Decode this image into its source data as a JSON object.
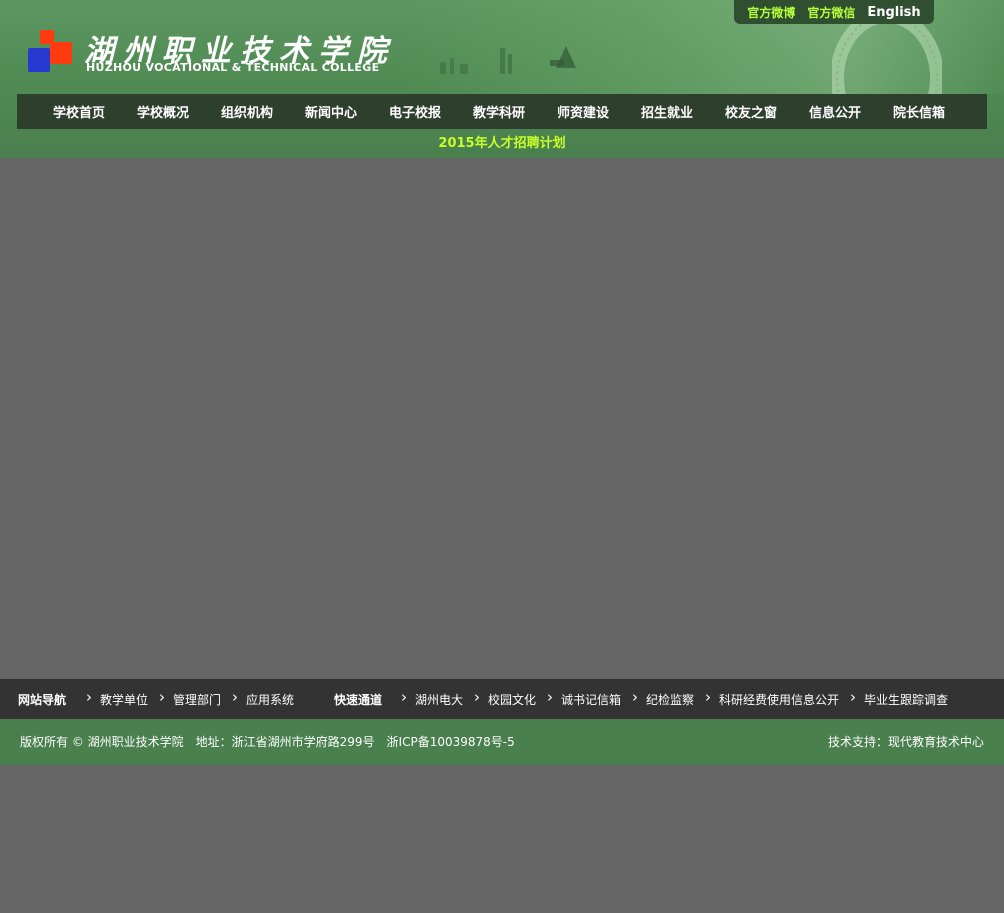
{
  "header": {
    "logo_cn": "湖州职业技术学院",
    "logo_en": "HUZHOU VOCATIONAL & TECHNICAL COLLEGE",
    "top_links": [
      "官方微博",
      "官方微信",
      "English"
    ]
  },
  "nav": {
    "items": [
      "学校首页",
      "学校概况",
      "组织机构",
      "新闻中心",
      "电子校报",
      "教学科研",
      "师资建设",
      "招生就业",
      "校友之窗",
      "信息公开",
      "院长信箱"
    ]
  },
  "notice": {
    "text": "2015年人才招聘计划"
  },
  "footer_nav": {
    "site_nav_title": "网站导航",
    "site_nav_links": [
      "教学单位",
      "管理部门",
      "应用系统"
    ],
    "quick_title": "快速通道",
    "quick_links": [
      "湖州电大",
      "校园文化",
      "诚书记信箱",
      "纪检监察",
      "科研经费使用信息公开",
      "毕业生跟踪调查"
    ]
  },
  "copyright": {
    "left": "版权所有 © 湖州职业技术学院　地址：浙江省湖州市学府路299号　浙ICP备10039878号-5",
    "right": "技术支持：现代教育技术中心"
  },
  "colors": {
    "header_green": "#4f8a53",
    "nav_dark": "#2e3f2e",
    "notice_lime": "#c6ff2a",
    "body_gray": "#666666",
    "footer_dark": "#333333"
  }
}
